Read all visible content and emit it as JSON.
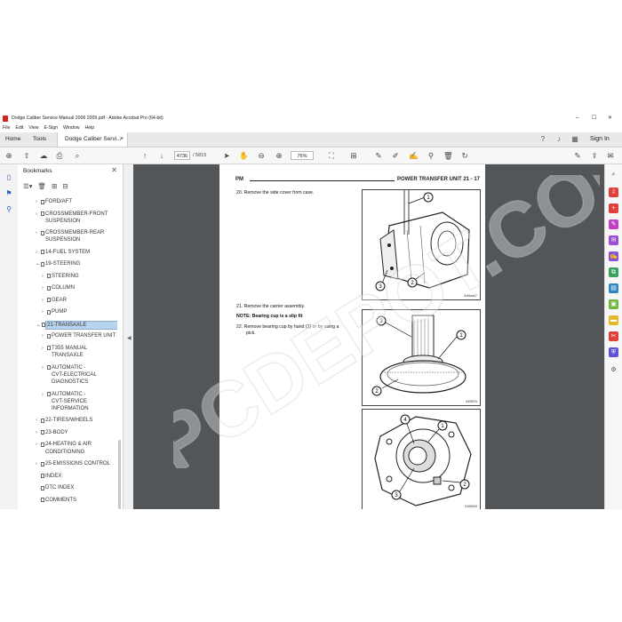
{
  "window": {
    "title": "Dodge Caliber Service Manual 2006 2009.pdf - Adobe Acrobat Pro (64-bit)",
    "controls": [
      "–",
      "☐",
      "✕"
    ]
  },
  "menu": [
    "File",
    "Edit",
    "View",
    "E-Sign",
    "Window",
    "Help"
  ],
  "tabs": {
    "home": "Home",
    "tools": "Tools",
    "document": "Dodge Caliber Servi...",
    "document_close": "×",
    "sign_in": "Sign In"
  },
  "toolbar": {
    "page_current": "4736",
    "page_total": "/ 5815",
    "zoom": "76%"
  },
  "bookmarks": {
    "title": "Bookmarks",
    "close": "✕",
    "items": [
      {
        "label": "FORD/AFT",
        "indent": 0
      },
      {
        "label": "CROSSMEMBER-FRONT",
        "indent": 0
      },
      {
        "label": "SUSPENSION",
        "indent": 0
      },
      {
        "label": "CROSSMEMBER-REAR",
        "indent": 0
      },
      {
        "label": "SUSPENSION",
        "indent": 0
      },
      {
        "label": "14-FUEL SYSTEM",
        "indent": 0
      },
      {
        "label": "19-STEERING",
        "indent": 0
      },
      {
        "label": "STEERING",
        "indent": 1
      },
      {
        "label": "COLUMN",
        "indent": 1
      },
      {
        "label": "GEAR",
        "indent": 1
      },
      {
        "label": "PUMP",
        "indent": 1
      },
      {
        "label": "21-TRANSAXLE",
        "indent": 0
      },
      {
        "label": "POWER TRANSFER UNIT",
        "indent": 1
      },
      {
        "label": "T355 MANUAL",
        "indent": 1
      },
      {
        "label": "TRANSAXLE",
        "indent": 1
      },
      {
        "label": "AUTOMATIC -",
        "indent": 1
      },
      {
        "label": "CVT-ELECTRICAL",
        "indent": 1
      },
      {
        "label": "DIAGNOSTICS",
        "indent": 1
      },
      {
        "label": "AUTOMATIC -",
        "indent": 1
      },
      {
        "label": "CVT-SERVICE",
        "indent": 1
      },
      {
        "label": "INFORMATION",
        "indent": 1
      },
      {
        "label": "22-TIRES/WHEELS",
        "indent": 0
      },
      {
        "label": "23-BODY",
        "indent": 0
      },
      {
        "label": "24-HEATING & AIR",
        "indent": 0
      },
      {
        "label": "CONDITIONING",
        "indent": 0
      },
      {
        "label": "25-EMISSIONS CONTROL",
        "indent": 0
      },
      {
        "label": "INDEX",
        "indent": 0
      },
      {
        "label": "DTC INDEX",
        "indent": 0
      },
      {
        "label": "COMMENTS",
        "indent": 0
      }
    ],
    "selected_label": "21-TRANSAXLE"
  },
  "page": {
    "header_left": "PM",
    "header_right": "POWER TRANSFER UNIT     21 - 17",
    "step20": "20.  Remove the side cover from case.",
    "step21": "21.  Remove the carrier assembly.",
    "note": "NOTE: Bearing cup is a slip fit",
    "step22a": "22.  Remove bearing cup by hand (1) or by using a",
    "step22b": "pick.",
    "fig1_id": "81f6ea47",
    "fig2_id": "8495f7a",
    "fig3_id": "81f6500f",
    "callouts": [
      "1",
      "2",
      "3",
      "4"
    ]
  },
  "watermark": "EPCDEPOT.COM",
  "icons": {
    "left_rail": [
      "pages-icon",
      "bookmark-icon",
      "attachment-icon"
    ],
    "right_panel": [
      "zoom-search-icon",
      "export-pdf-icon",
      "create-pdf-icon",
      "edit-pdf-icon",
      "comment-icon",
      "fill-sign-icon",
      "combine-icon",
      "organize-icon",
      "compress-icon",
      "redact-icon",
      "protect-icon",
      "more-tools-icon"
    ]
  }
}
